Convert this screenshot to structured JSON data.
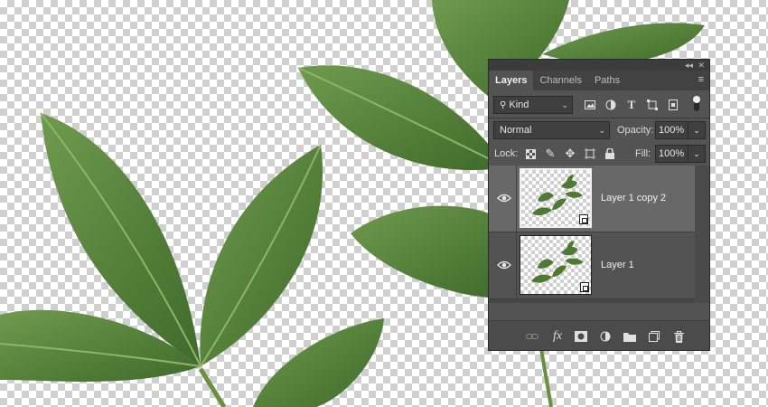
{
  "panel": {
    "collapse_glyph": "◂◂",
    "close_glyph": "✕",
    "tabs": [
      {
        "label": "Layers",
        "active": true
      },
      {
        "label": "Channels",
        "active": false
      },
      {
        "label": "Paths",
        "active": false
      }
    ],
    "menu_icon": "panel-menu-icon"
  },
  "filter": {
    "kind_label": "Kind",
    "icons": [
      "image-filter-icon",
      "adjustment-filter-icon",
      "type-filter-icon",
      "shape-filter-icon",
      "smart-object-filter-icon",
      "filter-toggle-icon"
    ]
  },
  "blend": {
    "mode": "Normal",
    "opacity_label": "Opacity:",
    "opacity_value": "100%"
  },
  "lock": {
    "label": "Lock:",
    "icons": [
      "lock-transparent-pixels-icon",
      "lock-image-pixels-icon",
      "lock-position-icon",
      "lock-artboard-icon",
      "lock-all-icon"
    ],
    "fill_label": "Fill:",
    "fill_value": "100%"
  },
  "layers": [
    {
      "name": "Layer 1 copy 2",
      "selected": true,
      "visible": true,
      "smart_object": true
    },
    {
      "name": "Layer 1",
      "selected": false,
      "visible": true,
      "smart_object": true
    }
  ],
  "bottom_icons": [
    "link-layers-icon",
    "fx-icon",
    "add-mask-icon",
    "adjustment-layer-icon",
    "new-group-icon",
    "new-layer-icon",
    "delete-icon"
  ],
  "colors": {
    "panel_bg": "#535353",
    "selected_layer_bg": "#686868",
    "leaf_green": "#4f7a34"
  }
}
